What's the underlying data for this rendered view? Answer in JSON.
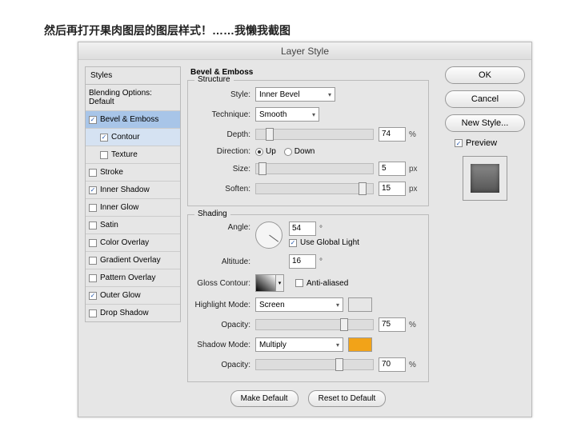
{
  "caption": "然后再打开果肉图层的图层样式！……我懒我截图",
  "dialog_title": "Layer Style",
  "styles_header": "Styles",
  "styles": [
    {
      "label": "Blending Options: Default",
      "checkbox": false,
      "checked": false,
      "sub": false,
      "sel": false
    },
    {
      "label": "Bevel & Emboss",
      "checkbox": true,
      "checked": true,
      "sub": false,
      "sel": true
    },
    {
      "label": "Contour",
      "checkbox": true,
      "checked": true,
      "sub": true,
      "sel": false,
      "subsel": true
    },
    {
      "label": "Texture",
      "checkbox": true,
      "checked": false,
      "sub": true,
      "sel": false
    },
    {
      "label": "Stroke",
      "checkbox": true,
      "checked": false,
      "sub": false,
      "sel": false
    },
    {
      "label": "Inner Shadow",
      "checkbox": true,
      "checked": true,
      "sub": false,
      "sel": false
    },
    {
      "label": "Inner Glow",
      "checkbox": true,
      "checked": false,
      "sub": false,
      "sel": false
    },
    {
      "label": "Satin",
      "checkbox": true,
      "checked": false,
      "sub": false,
      "sel": false
    },
    {
      "label": "Color Overlay",
      "checkbox": true,
      "checked": false,
      "sub": false,
      "sel": false
    },
    {
      "label": "Gradient Overlay",
      "checkbox": true,
      "checked": false,
      "sub": false,
      "sel": false
    },
    {
      "label": "Pattern Overlay",
      "checkbox": true,
      "checked": false,
      "sub": false,
      "sel": false
    },
    {
      "label": "Outer Glow",
      "checkbox": true,
      "checked": true,
      "sub": false,
      "sel": false
    },
    {
      "label": "Drop Shadow",
      "checkbox": true,
      "checked": false,
      "sub": false,
      "sel": false
    }
  ],
  "panel_title": "Bevel & Emboss",
  "structure": {
    "legend": "Structure",
    "style_label": "Style:",
    "style_value": "Inner Bevel",
    "technique_label": "Technique:",
    "technique_value": "Smooth",
    "depth_label": "Depth:",
    "depth_value": "74",
    "depth_unit": "%",
    "direction_label": "Direction:",
    "dir_up": "Up",
    "dir_down": "Down",
    "size_label": "Size:",
    "size_value": "5",
    "size_unit": "px",
    "soften_label": "Soften:",
    "soften_value": "15",
    "soften_unit": "px"
  },
  "shading": {
    "legend": "Shading",
    "angle_label": "Angle:",
    "angle_value": "54",
    "angle_unit": "°",
    "global_light": "Use Global Light",
    "altitude_label": "Altitude:",
    "altitude_value": "16",
    "altitude_unit": "°",
    "gloss_label": "Gloss Contour:",
    "antialiased": "Anti-aliased",
    "highlight_mode_label": "Highlight Mode:",
    "highlight_mode_value": "Screen",
    "highlight_color": "#ffffff",
    "highlight_opacity_label": "Opacity:",
    "highlight_opacity_value": "75",
    "highlight_opacity_unit": "%",
    "shadow_mode_label": "Shadow Mode:",
    "shadow_mode_value": "Multiply",
    "shadow_color": "#f2a318",
    "shadow_opacity_label": "Opacity:",
    "shadow_opacity_value": "70",
    "shadow_opacity_unit": "%"
  },
  "buttons": {
    "make_default": "Make Default",
    "reset_default": "Reset to Default",
    "ok": "OK",
    "cancel": "Cancel",
    "new_style": "New Style...",
    "preview": "Preview"
  }
}
